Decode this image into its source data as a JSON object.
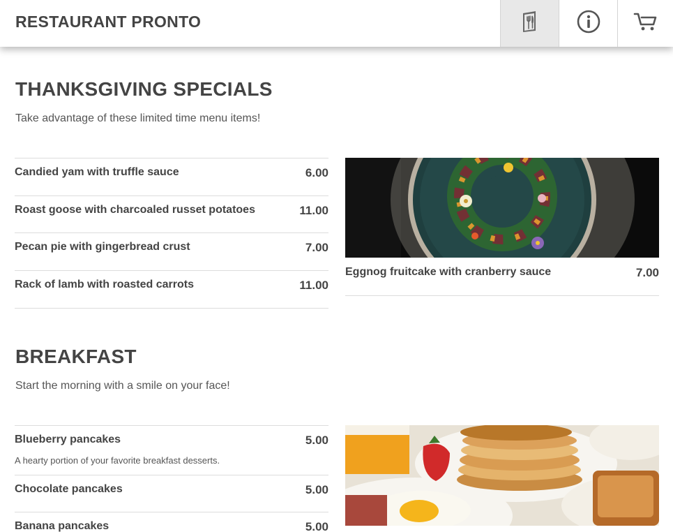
{
  "header": {
    "brand": "RESTAURANT PRONTO",
    "nav": [
      {
        "icon": "menu-book-icon",
        "active": true
      },
      {
        "icon": "info-icon",
        "active": false
      },
      {
        "icon": "cart-icon",
        "active": false
      }
    ]
  },
  "sections": [
    {
      "title": "THANKSGIVING SPECIALS",
      "subtitle": "Take advantage of these limited time menu items!",
      "items": [
        {
          "name": "Candied yam with truffle sauce",
          "price": "6.00"
        },
        {
          "name": "Roast goose with charcoaled russet potatoes",
          "price": "11.00"
        },
        {
          "name": "Pecan pie with gingerbread crust",
          "price": "7.00"
        },
        {
          "name": "Rack of lamb with roasted carrots",
          "price": "11.00"
        }
      ],
      "featured": {
        "name": "Eggnog fruitcake with cranberry sauce",
        "price": "7.00"
      }
    },
    {
      "title": "BREAKFAST",
      "subtitle": "Start the morning with a smile on your face!",
      "items": [
        {
          "name": "Blueberry pancakes",
          "price": "5.00",
          "description": "A hearty portion of your favorite breakfast desserts."
        },
        {
          "name": "Chocolate pancakes",
          "price": "5.00"
        },
        {
          "name": "Banana pancakes",
          "price": "5.00"
        }
      ]
    }
  ]
}
